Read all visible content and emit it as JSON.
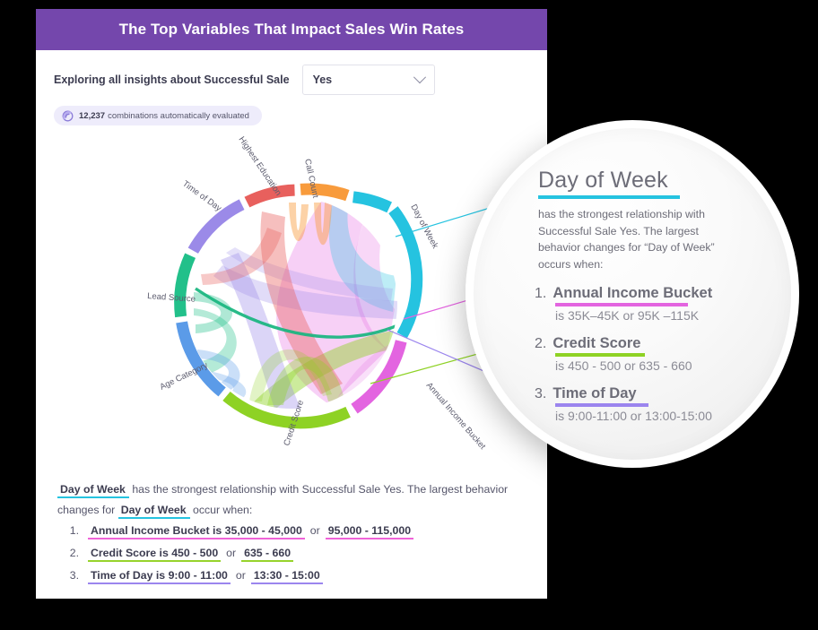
{
  "card": {
    "title": "The Top Variables That Impact Sales Win Rates",
    "header_color": "#7447ac"
  },
  "controls": {
    "explore_label": "Exploring all insights about Successful Sale",
    "dropdown_value": "Yes",
    "chevron_icon": "chevron-down-icon"
  },
  "badge": {
    "icon": "swirl-icon",
    "count": "12,237",
    "text": "combinations automatically evaluated"
  },
  "insight": {
    "subject": "Day of Week",
    "lead_text_1": "has the strongest relationship with Successful Sale Yes. The largest behavior",
    "lead_text_2a": "changes for",
    "lead_text_2b": "occur when:",
    "items": [
      {
        "num": "1.",
        "primary": "Annual Income Bucket is 35,000 - 45,000",
        "or": "or",
        "secondary": "95,000 - 115,000",
        "color": "#ef63d8"
      },
      {
        "num": "2.",
        "primary": "Credit Score is 450 - 500",
        "or": "or",
        "secondary": "635 - 660",
        "color": "#97d32c"
      },
      {
        "num": "3.",
        "primary": "Time of Day is 9:00 - 11:00",
        "or": "or",
        "secondary": "13:30 - 15:00",
        "color": "#9b85ee"
      }
    ]
  },
  "magnifier": {
    "title": "Day of Week",
    "title_underline_color": "#25c3e0",
    "description": "has the strongest relationship with Successful Sale Yes. The largest behavior changes for “Day of Week” occurs when:",
    "items": [
      {
        "num": "1.",
        "name": "Annual Income Bucket",
        "value": "is 35K–45K or 95K –115K",
        "color": "#e364e0"
      },
      {
        "num": "2.",
        "name": "Credit Score",
        "value": "is 450 - 500 or 635 - 660",
        "color": "#8ed224"
      },
      {
        "num": "3.",
        "name": "Time of Day",
        "value": "is 9:00-11:00 or 13:00-15:00",
        "color": "#9b85ee"
      }
    ]
  },
  "chart_data": {
    "type": "chord",
    "title": "Variable relationship chord diagram",
    "labels": [
      "Day of Week",
      "Call Count",
      "Highest Education",
      "Time of Day",
      "Lead Source",
      "Age Category",
      "Credit Score",
      "Annual Income Bucket"
    ],
    "segments": [
      {
        "name": "Day of Week",
        "color": "#25c3e0",
        "start_deg": -62,
        "end_deg": 14,
        "value": 76
      },
      {
        "name": "Call Count",
        "color": "#f89b3c",
        "start_deg": -85,
        "end_deg": -64,
        "value": 21
      },
      {
        "name": "Highest Education",
        "color": "#e8605d",
        "start_deg": -108,
        "end_deg": -87,
        "value": 21
      },
      {
        "name": "Time of Day",
        "color": "#9b8ae8",
        "start_deg": -155,
        "end_deg": -110,
        "value": 45
      },
      {
        "name": "Lead Source",
        "color": "#22c08a",
        "start_deg": -205,
        "end_deg": -157,
        "value": 48
      },
      {
        "name": "Age Category",
        "color": "#5b9be8",
        "start_deg": -250,
        "end_deg": -207,
        "value": 43
      },
      {
        "name": "Credit Score",
        "color": "#8ed224",
        "start_deg": -305,
        "end_deg": -252,
        "value": 53
      },
      {
        "name": "Annual Income Bucket",
        "color": "#e364e0",
        "start_deg": 16,
        "end_deg": 56,
        "value": 53
      }
    ],
    "ribbons": [
      {
        "source": "Day of Week",
        "target": "Annual Income Bucket",
        "color": "#e364e0",
        "opacity": 0.34,
        "value": 40
      },
      {
        "source": "Day of Week",
        "target": "Lead Source",
        "color": "#22c08a",
        "opacity": 0.8,
        "value": 5
      },
      {
        "source": "Day of Week",
        "target": "Credit Score",
        "color": "#8ed224",
        "opacity": 0.42,
        "value": 13
      },
      {
        "source": "Day of Week",
        "target": "Time of Day",
        "color": "#9b8ae8",
        "opacity": 0.4,
        "value": 15
      },
      {
        "source": "Annual Income Bucket",
        "target": "Highest Education",
        "color": "#e8605d",
        "opacity": 0.42,
        "value": 14
      },
      {
        "source": "Call Count",
        "target": "Call Count",
        "color": "#f89b3c",
        "opacity": 0.42,
        "value": 10
      },
      {
        "source": "Credit Score",
        "target": "Credit Score",
        "color": "#8ed224",
        "opacity": 0.38,
        "value": 20
      },
      {
        "source": "Lead Source",
        "target": "Lead Source",
        "color": "#22c08a",
        "opacity": 0.36,
        "value": 18
      },
      {
        "source": "Age Category",
        "target": "Lead Source",
        "color": "#5b9be8",
        "opacity": 0.36,
        "value": 14
      },
      {
        "source": "Time of Day",
        "target": "Credit Score",
        "color": "#9b8ae8",
        "opacity": 0.36,
        "value": 16
      }
    ]
  }
}
